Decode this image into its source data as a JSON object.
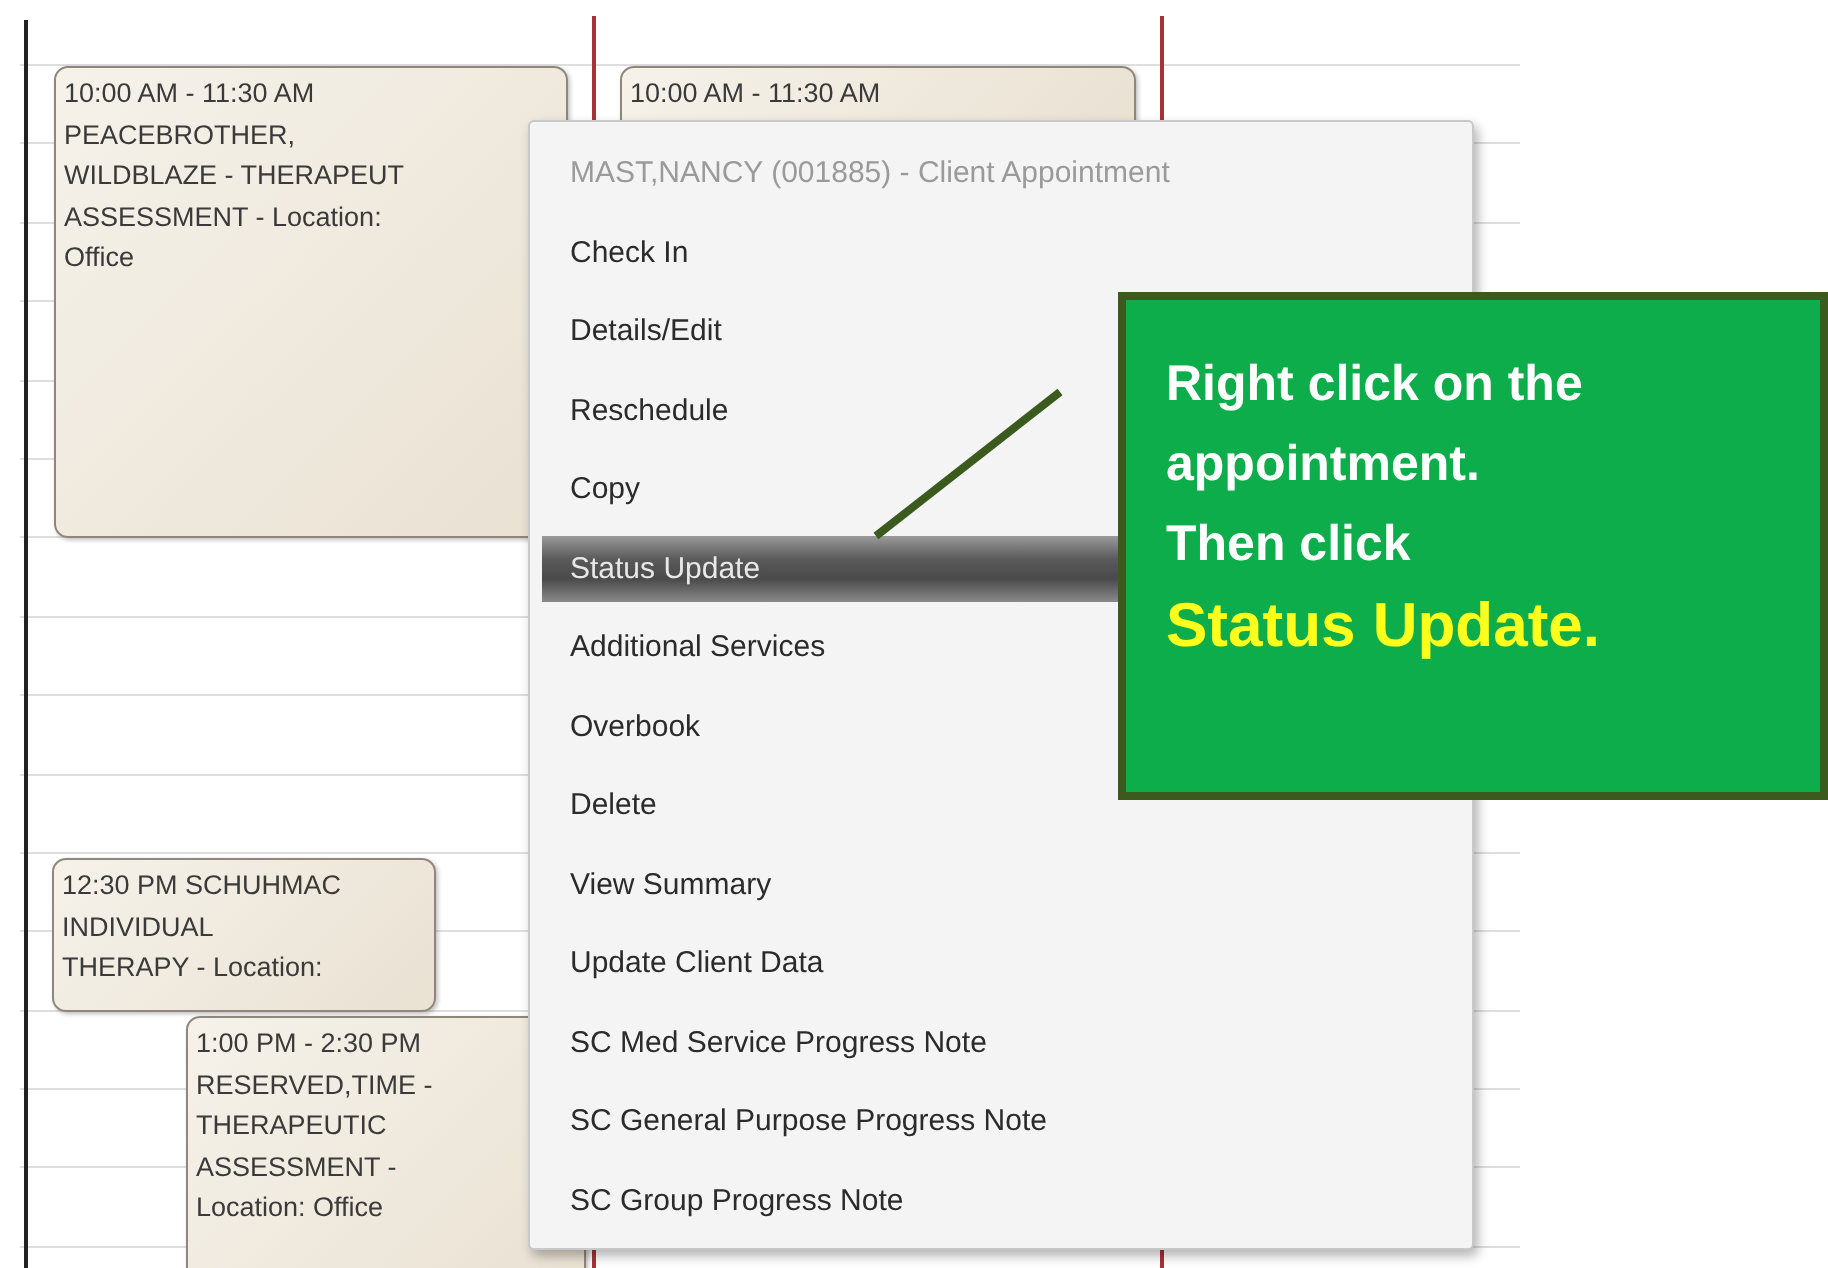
{
  "calendar": {
    "appointments": [
      {
        "lines": [
          "10:00 AM - 11:30 AM",
          "PEACEBROTHER,",
          "WILDBLAZE - THERAPEUT",
          "ASSESSMENT - Location:",
          "Office"
        ]
      },
      {
        "lines": [
          "10:00 AM - 11:30 AM"
        ]
      },
      {
        "lines": [
          "12:30 PM SCHUHMAC",
          "INDIVIDUAL",
          "THERAPY - Location:"
        ]
      },
      {
        "lines": [
          "1:00 PM - 2:30 PM",
          "RESERVED,TIME -",
          "THERAPEUTIC",
          "ASSESSMENT -",
          "Location: Office"
        ]
      }
    ]
  },
  "context_menu": {
    "header": "MAST,NANCY (001885) - Client Appointment",
    "items": [
      {
        "label": "Check In",
        "selected": false
      },
      {
        "label": "Details/Edit",
        "selected": false
      },
      {
        "label": "Reschedule",
        "selected": false
      },
      {
        "label": "Copy",
        "selected": false
      },
      {
        "label": "Status Update",
        "selected": true
      },
      {
        "label": "Additional Services",
        "selected": false
      },
      {
        "label": "Overbook",
        "selected": false
      },
      {
        "label": "Delete",
        "selected": false
      },
      {
        "label": "View Summary",
        "selected": false
      },
      {
        "label": "Update Client Data",
        "selected": false
      },
      {
        "label": "SC Med Service Progress Note",
        "selected": false
      },
      {
        "label": "SC General Purpose Progress Note",
        "selected": false
      },
      {
        "label": "SC Group Progress Note",
        "selected": false
      }
    ]
  },
  "callout": {
    "lines": [
      {
        "text": "Right click on the",
        "highlight": false
      },
      {
        "text": "appointment.",
        "highlight": false
      },
      {
        "text": "Then click",
        "highlight": false
      },
      {
        "text": "Status Update.",
        "highlight": true
      }
    ]
  }
}
